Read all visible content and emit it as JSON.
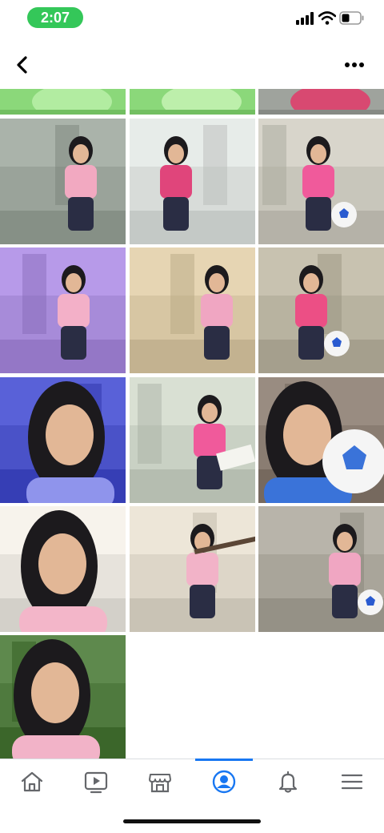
{
  "status_bar": {
    "time": "2:07",
    "time_pill_color": "#34c759"
  },
  "nav": {
    "back_icon": "chevron-left-icon",
    "more_icon": "more-horizontal-icon"
  },
  "photos": [
    {
      "kind": "green-partial",
      "bg": "#8bd87a",
      "accent": "#b9f0a8"
    },
    {
      "kind": "green-partial",
      "bg": "#8bd87a",
      "accent": "#c5f3b4"
    },
    {
      "kind": "pink-partial",
      "bg": "#9fa39d",
      "accent": "#e23a6a"
    },
    {
      "kind": "tree-pink",
      "bg": "#9aa39a",
      "accent": "#f2a9c1"
    },
    {
      "kind": "leaves-pink",
      "bg": "#d8dcd9",
      "accent": "#e0457b"
    },
    {
      "kind": "sitting-ball",
      "bg": "#c8c6bb",
      "accent": "#f05a9b"
    },
    {
      "kind": "violet-wall",
      "bg": "#a78bd9",
      "accent": "#f3b0c8"
    },
    {
      "kind": "stairs",
      "bg": "#d7c6a3",
      "accent": "#f0a6c2"
    },
    {
      "kind": "ball-hold",
      "bg": "#b8b3a0",
      "accent": "#ec4f85"
    },
    {
      "kind": "blue-portrait",
      "bg": "#4a52c8",
      "accent": "#8f94ec"
    },
    {
      "kind": "reading",
      "bg": "#c9d1c4",
      "accent": "#f05a9b"
    },
    {
      "kind": "ball-selfie",
      "bg": "#8a7d72",
      "accent": "#3a73d9"
    },
    {
      "kind": "portrait-light",
      "bg": "#e7e3dc",
      "accent": "#f3b6c9"
    },
    {
      "kind": "stick",
      "bg": "#ddd6c8",
      "accent": "#f2b3c8"
    },
    {
      "kind": "squat-ball",
      "bg": "#a9a59a",
      "accent": "#f0a6c2"
    },
    {
      "kind": "portrait-green",
      "bg": "#4f7a3e",
      "accent": "#f2b3c8"
    }
  ],
  "tabs": [
    {
      "name": "home",
      "icon": "home-icon",
      "active": false
    },
    {
      "name": "watch",
      "icon": "video-play-icon",
      "active": false
    },
    {
      "name": "marketplace",
      "icon": "marketplace-icon",
      "active": false
    },
    {
      "name": "profile",
      "icon": "profile-icon",
      "active": true
    },
    {
      "name": "notifications",
      "icon": "bell-icon",
      "active": false
    },
    {
      "name": "menu",
      "icon": "menu-icon",
      "active": false
    }
  ],
  "colors": {
    "active": "#1877f2",
    "inactive": "#65676b",
    "divider": "#dadde1"
  }
}
